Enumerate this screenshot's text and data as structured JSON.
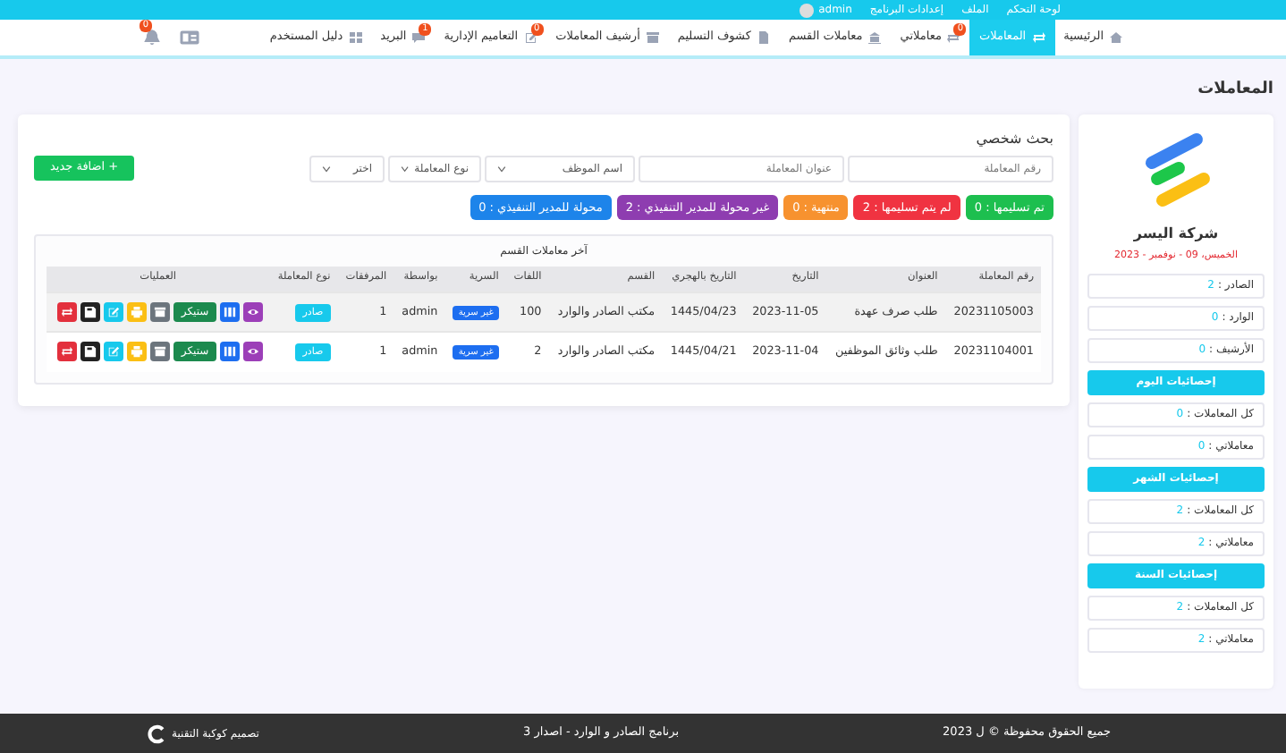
{
  "top_bar": {
    "items": [
      "لوحة التحكم",
      "الملف",
      "إعدادات البرنامج"
    ],
    "user": "admin"
  },
  "nav": {
    "items": [
      {
        "label": "الرئيسية",
        "selected": false
      },
      {
        "label": "المعاملات",
        "selected": true
      },
      {
        "label": "معاملاتي",
        "badge": "0",
        "selected": false
      },
      {
        "label": "معاملات القسم",
        "selected": false
      },
      {
        "label": "كشوف التسليم",
        "selected": false
      },
      {
        "label": "أرشيف المعاملات",
        "selected": false
      },
      {
        "label": "التعاميم الإدارية",
        "badge": "0",
        "selected": false
      },
      {
        "label": "البريد",
        "badge": "1",
        "selected": false
      },
      {
        "label": "دليل المستخدم",
        "selected": false
      }
    ],
    "bell_badge": "0"
  },
  "page_title": "المعاملات",
  "sidebar": {
    "company": "شركة اليسر",
    "date": "الخميس، 09 - نوفمبر - 2023",
    "groups": [
      {
        "items": [
          {
            "label": "الصادر :",
            "value": "2"
          },
          {
            "label": "الوارد :",
            "value": "0"
          },
          {
            "label": "الأرشيف :",
            "value": "0"
          }
        ]
      },
      {
        "header": "إحصائيات اليوم",
        "items": [
          {
            "label": "كل المعاملات :",
            "value": "0"
          },
          {
            "label": "معاملاتي :",
            "value": "0"
          }
        ]
      },
      {
        "header": "إحصائيات الشهر",
        "items": [
          {
            "label": "كل المعاملات :",
            "value": "2"
          },
          {
            "label": "معاملاتي :",
            "value": "2"
          }
        ]
      },
      {
        "header": "إحصائيات السنة",
        "items": [
          {
            "label": "كل المعاملات :",
            "value": "2"
          },
          {
            "label": "معاملاتي :",
            "value": "2"
          }
        ]
      }
    ]
  },
  "search": {
    "title": "بحث شخصي",
    "fields": [
      {
        "kind": "input",
        "placeholder": "رقم المعاملة"
      },
      {
        "kind": "input",
        "placeholder": "عنوان المعاملة"
      },
      {
        "kind": "select",
        "value": "اسم الموظف"
      },
      {
        "kind": "select",
        "value": "نوع المعاملة"
      },
      {
        "kind": "select",
        "value": "اختر"
      }
    ],
    "add_button": "+ اضافة جديد"
  },
  "status_pills": [
    {
      "label": "تم تسليمها : 0",
      "color": "#1dbf4f"
    },
    {
      "label": "لم يتم تسليمها : 2",
      "color": "#f03341"
    },
    {
      "label": "منتهية : 0",
      "color": "#f7922f"
    },
    {
      "label": "غير محولة للمدير التنفيذي : 2",
      "color": "#8e3db0"
    },
    {
      "label": "محولة للمدير التنفيذي : 0",
      "color": "#1d84ea"
    }
  ],
  "table": {
    "title": "آخر معاملات القسم",
    "columns": [
      "رقم المعاملة",
      "العنوان",
      "التاريخ",
      "التاريخ بالهجري",
      "القسم",
      "اللفات",
      "السرية",
      "بواسطة",
      "المرفقات",
      "نوع المعاملة",
      "العمليات"
    ],
    "rows": [
      {
        "cells": [
          "20231105003",
          "طلب صرف عهدة",
          "2023-11-05",
          "1445/04/23",
          "مكتب الصادر والوارد",
          "100"
        ],
        "secrecy": "غير سرية",
        "cells2": [
          "admin",
          "1"
        ],
        "type": "صادر",
        "actions": [
          {
            "kind": "view"
          },
          {
            "kind": "columns"
          },
          {
            "kind": "sticker",
            "label": "ستيكر"
          },
          {
            "kind": "archive"
          },
          {
            "kind": "print"
          },
          {
            "kind": "edit"
          },
          {
            "kind": "save"
          },
          {
            "kind": "transfer"
          }
        ]
      },
      {
        "cells": [
          "20231104001",
          "طلب وثائق الموظفين",
          "2023-11-04",
          "1445/04/21",
          "مكتب الصادر والوارد",
          "2"
        ],
        "secrecy": "غير سرية",
        "cells2": [
          "admin",
          "1"
        ],
        "type": "صادر",
        "actions": [
          {
            "kind": "view"
          },
          {
            "kind": "columns"
          },
          {
            "kind": "sticker",
            "label": "ستيكر"
          },
          {
            "kind": "archive"
          },
          {
            "kind": "print"
          },
          {
            "kind": "edit"
          },
          {
            "kind": "save"
          },
          {
            "kind": "transfer"
          }
        ]
      }
    ]
  },
  "footer": {
    "rights": "جميع الحقوق محفوظة © ل 2023",
    "program": "برنامج الصادر و الوارد - اصدار 3",
    "designer": "تصميم كوكبة التقنية"
  }
}
